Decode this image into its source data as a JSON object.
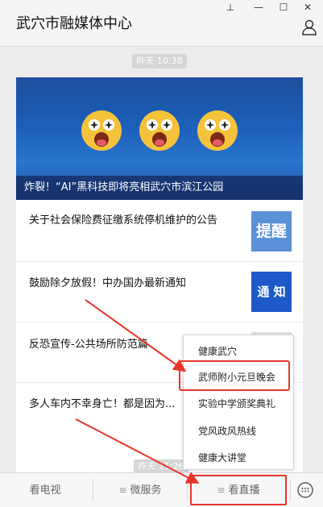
{
  "window": {
    "title": "武穴市融媒体中心",
    "controls": {
      "pin": "⊥",
      "minimize": "—",
      "maximize": "☐",
      "close": "✕"
    }
  },
  "timestamps": {
    "top": "昨天 10:38",
    "bottom": "昨天 11:26"
  },
  "banner": {
    "caption": "炸裂！“AI”黑科技即将亮相武穴市滨江公园"
  },
  "news": [
    {
      "title": "关于社会保险费征缴系统停机维护的公告",
      "thumb_text": "提醒",
      "thumb_color": "#5b8fd8"
    },
    {
      "title": "鼓励除夕放假！中办国办最新通知",
      "thumb_text": "通 知",
      "thumb_color": "#1d59c8"
    },
    {
      "title": "反恐宣传-公共场所防范篇",
      "thumb_text": "",
      "thumb_color": "#e0e0e0"
    },
    {
      "title": "多人车内不幸身亡！都是因为...",
      "thumb_text": "",
      "thumb_color": "#e0e0e0"
    }
  ],
  "popup_menu": {
    "items": [
      "健康武穴",
      "武师附小元旦晚会",
      "实验中学颁奖典礼",
      "党风政风热线",
      "健康大讲堂"
    ],
    "highlighted": "武师附小元旦晚会"
  },
  "bottom_tabs": [
    {
      "label": "看电视",
      "has_menu": false
    },
    {
      "label": "微服务",
      "has_menu": true
    },
    {
      "label": "看直播",
      "has_menu": true
    }
  ],
  "highlighted_tab": "看直播",
  "colors": {
    "accent_red": "#e8342b",
    "banner_blue": "#1c5fba"
  }
}
